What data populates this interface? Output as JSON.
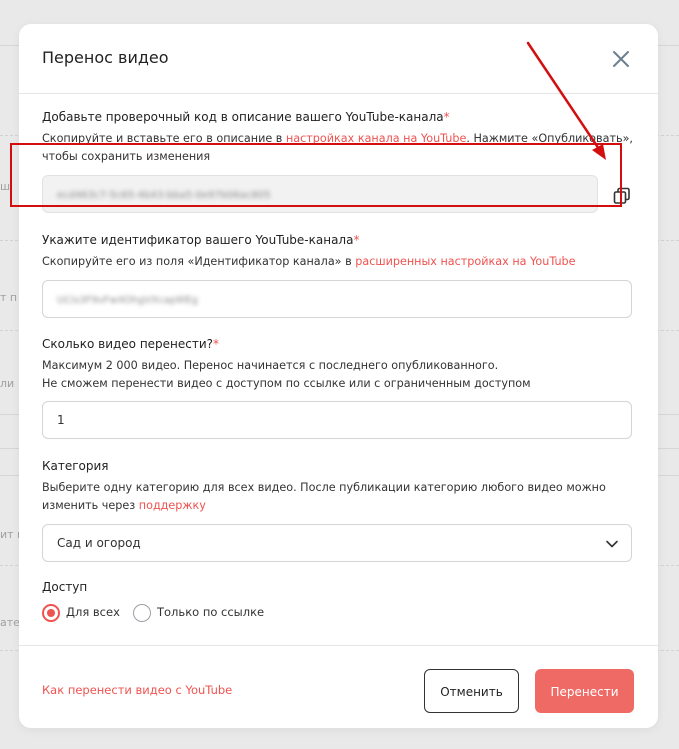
{
  "background": {
    "fragments": [
      "ш",
      "т п",
      "ли",
      "ит в",
      "ате"
    ]
  },
  "modal": {
    "title": "Перенос видео",
    "close_icon": "close-icon",
    "section_code": {
      "label": "Добавьте проверочный код в описание вашего YouTube-канала",
      "required_mark": "*",
      "desc_prefix": "Скопируйте и вставьте его в описание в ",
      "desc_link": "настройках канала на YouTube",
      "desc_suffix": ". Нажмите «Опубликовать»,",
      "desc_line2": "чтобы сохранить изменения",
      "code_value": "ecd463c7-5c65-4b43-bba5-0e97b06ac805",
      "copy_icon": "copy-icon"
    },
    "section_channel": {
      "label": "Укажите идентификатор вашего YouTube-канала",
      "required_mark": "*",
      "desc_prefix": "Скопируйте его из поля «Идентификатор канала» в ",
      "desc_link": "расширенных настройках на YouTube",
      "channel_id_value": "UCis3F9vFwXOhgVXcap9lEg"
    },
    "section_count": {
      "label": "Сколько видео перенести?",
      "required_mark": "*",
      "desc_line1": "Максимум 2 000 видео. Перенос начинается с последнего опубликованного.",
      "desc_line2": "Не сможем перенести видео с доступом по ссылке или с ограниченным доступом",
      "count_value": "1"
    },
    "section_category": {
      "label": "Категория",
      "desc_line1": "Выберите одну категорию для всех видео. После публикации категорию любого видео можно",
      "desc_line2_prefix": "изменить через ",
      "desc_line2_link": "поддержку",
      "selected": "Сад и огород",
      "chevron_icon": "chevron-down-icon"
    },
    "section_access": {
      "label": "Доступ",
      "options": [
        {
          "label": "Для всех",
          "checked": true
        },
        {
          "label": "Только по ссылке",
          "checked": false
        }
      ]
    },
    "footer": {
      "help_link": "Как перенести видео с YouTube",
      "cancel_label": "Отменить",
      "submit_label": "Перенести"
    }
  },
  "colors": {
    "accent": "#ef5350",
    "primary_button": "#ef6a65",
    "annotation": "#d40e0e"
  }
}
